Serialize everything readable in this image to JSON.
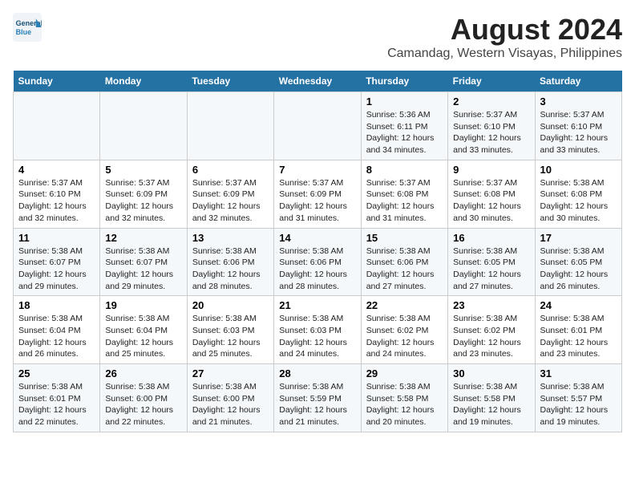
{
  "logo": {
    "general": "General",
    "blue": "Blue"
  },
  "title": "August 2024",
  "subtitle": "Camandag, Western Visayas, Philippines",
  "weekdays": [
    "Sunday",
    "Monday",
    "Tuesday",
    "Wednesday",
    "Thursday",
    "Friday",
    "Saturday"
  ],
  "weeks": [
    [
      {
        "day": "",
        "info": ""
      },
      {
        "day": "",
        "info": ""
      },
      {
        "day": "",
        "info": ""
      },
      {
        "day": "",
        "info": ""
      },
      {
        "day": "1",
        "info": "Sunrise: 5:36 AM\nSunset: 6:11 PM\nDaylight: 12 hours\nand 34 minutes."
      },
      {
        "day": "2",
        "info": "Sunrise: 5:37 AM\nSunset: 6:10 PM\nDaylight: 12 hours\nand 33 minutes."
      },
      {
        "day": "3",
        "info": "Sunrise: 5:37 AM\nSunset: 6:10 PM\nDaylight: 12 hours\nand 33 minutes."
      }
    ],
    [
      {
        "day": "4",
        "info": "Sunrise: 5:37 AM\nSunset: 6:10 PM\nDaylight: 12 hours\nand 32 minutes."
      },
      {
        "day": "5",
        "info": "Sunrise: 5:37 AM\nSunset: 6:09 PM\nDaylight: 12 hours\nand 32 minutes."
      },
      {
        "day": "6",
        "info": "Sunrise: 5:37 AM\nSunset: 6:09 PM\nDaylight: 12 hours\nand 32 minutes."
      },
      {
        "day": "7",
        "info": "Sunrise: 5:37 AM\nSunset: 6:09 PM\nDaylight: 12 hours\nand 31 minutes."
      },
      {
        "day": "8",
        "info": "Sunrise: 5:37 AM\nSunset: 6:08 PM\nDaylight: 12 hours\nand 31 minutes."
      },
      {
        "day": "9",
        "info": "Sunrise: 5:37 AM\nSunset: 6:08 PM\nDaylight: 12 hours\nand 30 minutes."
      },
      {
        "day": "10",
        "info": "Sunrise: 5:38 AM\nSunset: 6:08 PM\nDaylight: 12 hours\nand 30 minutes."
      }
    ],
    [
      {
        "day": "11",
        "info": "Sunrise: 5:38 AM\nSunset: 6:07 PM\nDaylight: 12 hours\nand 29 minutes."
      },
      {
        "day": "12",
        "info": "Sunrise: 5:38 AM\nSunset: 6:07 PM\nDaylight: 12 hours\nand 29 minutes."
      },
      {
        "day": "13",
        "info": "Sunrise: 5:38 AM\nSunset: 6:06 PM\nDaylight: 12 hours\nand 28 minutes."
      },
      {
        "day": "14",
        "info": "Sunrise: 5:38 AM\nSunset: 6:06 PM\nDaylight: 12 hours\nand 28 minutes."
      },
      {
        "day": "15",
        "info": "Sunrise: 5:38 AM\nSunset: 6:06 PM\nDaylight: 12 hours\nand 27 minutes."
      },
      {
        "day": "16",
        "info": "Sunrise: 5:38 AM\nSunset: 6:05 PM\nDaylight: 12 hours\nand 27 minutes."
      },
      {
        "day": "17",
        "info": "Sunrise: 5:38 AM\nSunset: 6:05 PM\nDaylight: 12 hours\nand 26 minutes."
      }
    ],
    [
      {
        "day": "18",
        "info": "Sunrise: 5:38 AM\nSunset: 6:04 PM\nDaylight: 12 hours\nand 26 minutes."
      },
      {
        "day": "19",
        "info": "Sunrise: 5:38 AM\nSunset: 6:04 PM\nDaylight: 12 hours\nand 25 minutes."
      },
      {
        "day": "20",
        "info": "Sunrise: 5:38 AM\nSunset: 6:03 PM\nDaylight: 12 hours\nand 25 minutes."
      },
      {
        "day": "21",
        "info": "Sunrise: 5:38 AM\nSunset: 6:03 PM\nDaylight: 12 hours\nand 24 minutes."
      },
      {
        "day": "22",
        "info": "Sunrise: 5:38 AM\nSunset: 6:02 PM\nDaylight: 12 hours\nand 24 minutes."
      },
      {
        "day": "23",
        "info": "Sunrise: 5:38 AM\nSunset: 6:02 PM\nDaylight: 12 hours\nand 23 minutes."
      },
      {
        "day": "24",
        "info": "Sunrise: 5:38 AM\nSunset: 6:01 PM\nDaylight: 12 hours\nand 23 minutes."
      }
    ],
    [
      {
        "day": "25",
        "info": "Sunrise: 5:38 AM\nSunset: 6:01 PM\nDaylight: 12 hours\nand 22 minutes."
      },
      {
        "day": "26",
        "info": "Sunrise: 5:38 AM\nSunset: 6:00 PM\nDaylight: 12 hours\nand 22 minutes."
      },
      {
        "day": "27",
        "info": "Sunrise: 5:38 AM\nSunset: 6:00 PM\nDaylight: 12 hours\nand 21 minutes."
      },
      {
        "day": "28",
        "info": "Sunrise: 5:38 AM\nSunset: 5:59 PM\nDaylight: 12 hours\nand 21 minutes."
      },
      {
        "day": "29",
        "info": "Sunrise: 5:38 AM\nSunset: 5:58 PM\nDaylight: 12 hours\nand 20 minutes."
      },
      {
        "day": "30",
        "info": "Sunrise: 5:38 AM\nSunset: 5:58 PM\nDaylight: 12 hours\nand 19 minutes."
      },
      {
        "day": "31",
        "info": "Sunrise: 5:38 AM\nSunset: 5:57 PM\nDaylight: 12 hours\nand 19 minutes."
      }
    ]
  ]
}
